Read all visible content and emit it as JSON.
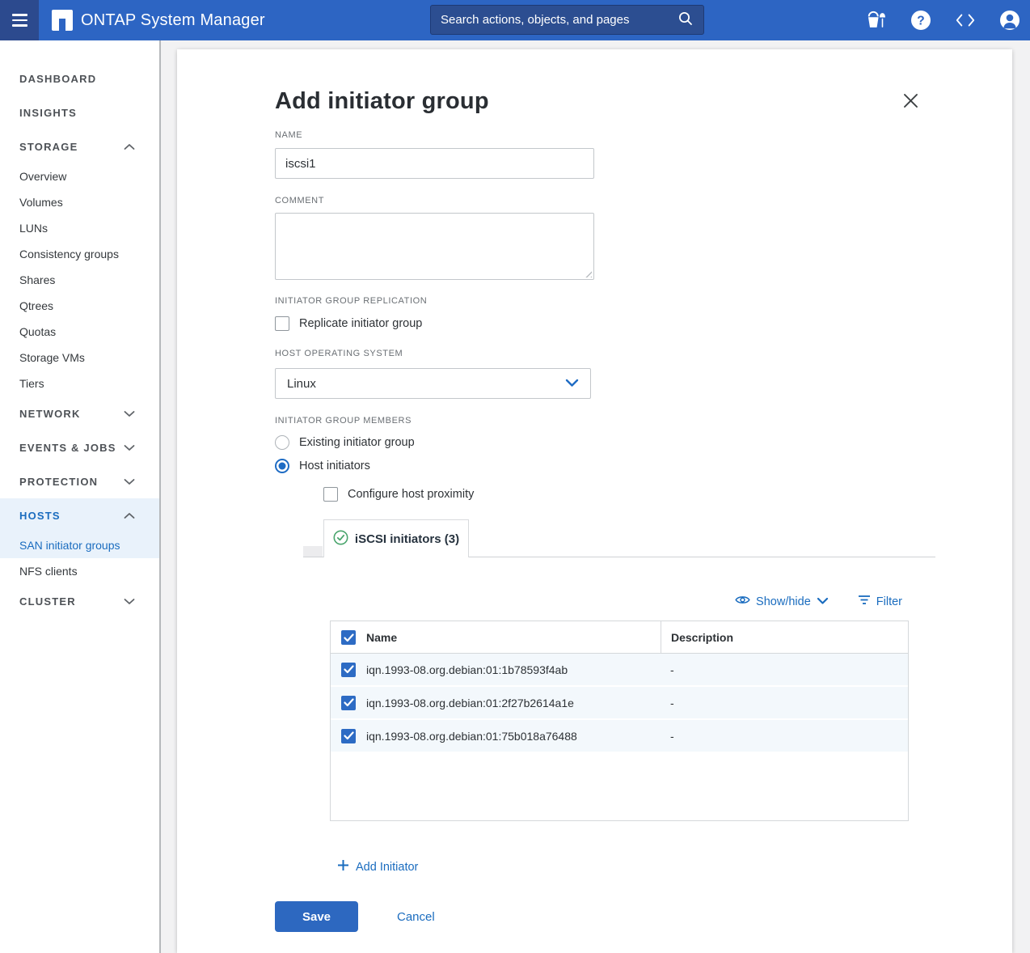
{
  "topbar": {
    "title": "ONTAP System Manager",
    "search_placeholder": "Search actions, objects, and pages",
    "icons": [
      "hamburger-menu-icon",
      "netapp-logo",
      "search-icon",
      "sandbox-bucket-icon",
      "help-icon",
      "code-icon",
      "user-avatar-icon"
    ]
  },
  "sidebar": {
    "dashboard": "DASHBOARD",
    "insights": "INSIGHTS",
    "storage": "STORAGE",
    "storage_items": [
      "Overview",
      "Volumes",
      "LUNs",
      "Consistency groups",
      "Shares",
      "Qtrees",
      "Quotas",
      "Storage VMs",
      "Tiers"
    ],
    "network": "NETWORK",
    "events_jobs": "EVENTS & JOBS",
    "protection": "PROTECTION",
    "hosts": "HOSTS",
    "hosts_items": [
      "SAN initiator groups",
      "NFS clients"
    ],
    "cluster": "CLUSTER",
    "active_item": "SAN initiator groups"
  },
  "dialog": {
    "title": "Add initiator group",
    "name_label": "NAME",
    "name_value": "iscsi1",
    "comment_label": "COMMENT",
    "comment_value": "",
    "replication_label": "INITIATOR GROUP REPLICATION",
    "replicate_checkbox": {
      "label": "Replicate initiator group",
      "checked": false
    },
    "host_os_label": "HOST OPERATING SYSTEM",
    "host_os_value": "Linux",
    "members_label": "INITIATOR GROUP MEMBERS",
    "member_options": [
      {
        "label": "Existing initiator group",
        "selected": false
      },
      {
        "label": "Host initiators",
        "selected": true
      }
    ],
    "proximity_checkbox": {
      "label": "Configure host proximity",
      "checked": false
    },
    "tab": {
      "label": "iSCSI initiators (3)",
      "status_icon": "green-check-circle"
    },
    "showhide_label": "Show/hide",
    "filter_label": "Filter",
    "table": {
      "headers": [
        "Name",
        "Description"
      ],
      "select_all_checked": true,
      "rows": [
        {
          "checked": true,
          "name": "iqn.1993-08.org.debian:01:1b78593f4ab",
          "description": "-"
        },
        {
          "checked": true,
          "name": "iqn.1993-08.org.debian:01:2f27b2614a1e",
          "description": "-"
        },
        {
          "checked": true,
          "name": "iqn.1993-08.org.debian:01:75b018a76488",
          "description": "-"
        }
      ]
    },
    "add_initiator_label": "Add Initiator",
    "save_label": "Save",
    "cancel_label": "Cancel"
  },
  "colors": {
    "topbar": "#2d65c3",
    "topbar_dark": "#2c4a8e",
    "accent_link": "#1a6cbf",
    "primary_button": "#2d68c0",
    "success_green": "#4aa56d",
    "row_highlight": "#f3f8fc",
    "sidebar_active_bg": "#e9f2fb"
  }
}
